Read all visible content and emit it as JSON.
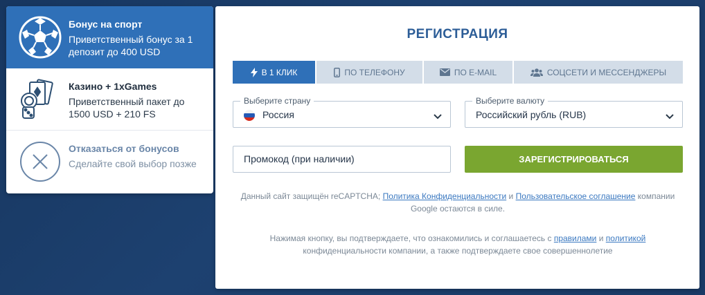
{
  "bonuses": [
    {
      "title": "Бонус на спорт",
      "desc": "Приветственный бонус за 1 депозит до 400 USD",
      "icon": "soccer-ball-icon"
    },
    {
      "title": "Казино + 1xGames",
      "desc": "Приветственный пакет до 1500 USD + 210 FS",
      "icon": "casino-cards-icon"
    },
    {
      "title": "Отказаться от бонусов",
      "desc": "Сделайте свой выбор позже",
      "icon": "close-circle-icon"
    }
  ],
  "registration": {
    "title": "РЕГИСТРАЦИЯ",
    "tabs": [
      {
        "label": "В 1 КЛИК",
        "icon": "lightning-icon"
      },
      {
        "label": "ПО ТЕЛЕФОНУ",
        "icon": "phone-icon"
      },
      {
        "label": "ПО E-MAIL",
        "icon": "envelope-icon"
      },
      {
        "label": "СОЦСЕТИ И МЕССЕНДЖЕРЫ",
        "icon": "users-icon"
      }
    ],
    "country": {
      "label": "Выберите страну",
      "value": "Россия"
    },
    "currency": {
      "label": "Выберите валюту",
      "value": "Российский рубль (RUB)"
    },
    "promo_placeholder": "Промокод (при наличии)",
    "submit": "ЗАРЕГИСТРИРОВАТЬСЯ"
  },
  "captcha_note": {
    "prefix": "Данный сайт защищён reCAPTCHA;",
    "link1": "Политика Конфиденциальности",
    "and": "и",
    "link2": "Пользовательское соглашение",
    "suffix": "компании Google остаются в силе."
  },
  "terms_note": {
    "prefix": "Нажимая кнопку, вы подтверждаете, что ознакомились и соглашаетесь с",
    "link1": "правилами",
    "and": "и",
    "link2": "политикой",
    "suffix": "конфиденциальности компании, а также подтверждаете свое совершеннолетие"
  },
  "colors": {
    "accent": "#2f70b8",
    "submit": "#7aa630",
    "title": "#2c5d97"
  }
}
